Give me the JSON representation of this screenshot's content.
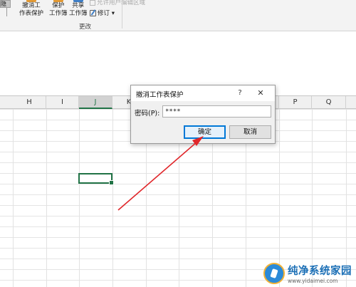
{
  "ribbon": {
    "partial_label": "隐藏",
    "buttons": [
      {
        "line1": "撤消工",
        "line2": "作表保护"
      },
      {
        "line1": "保护",
        "line2": "工作簿"
      },
      {
        "line1": "共享",
        "line2": "工作簿"
      }
    ],
    "allow_edit_label": "允许用户编辑区域",
    "track_changes_label": "修订",
    "track_changes_caret": "▾",
    "group_label": "更改"
  },
  "sheet": {
    "columns": [
      "H",
      "I",
      "J",
      "K",
      "L",
      "M",
      "N",
      "O",
      "P",
      "Q"
    ],
    "selected_column": "J"
  },
  "dialog": {
    "title": "撤消工作表保护",
    "help_glyph": "?",
    "close_glyph": "✕",
    "password_label": "密码(P):",
    "password_value": "****",
    "ok_label": "确定",
    "cancel_label": "取消"
  },
  "watermark": {
    "title": "纯净系统家园",
    "url": "www.yidaimei.com"
  },
  "colors": {
    "excel_green": "#217346",
    "focus_blue": "#0078d7",
    "annotation_arrow": "#e0262a"
  }
}
